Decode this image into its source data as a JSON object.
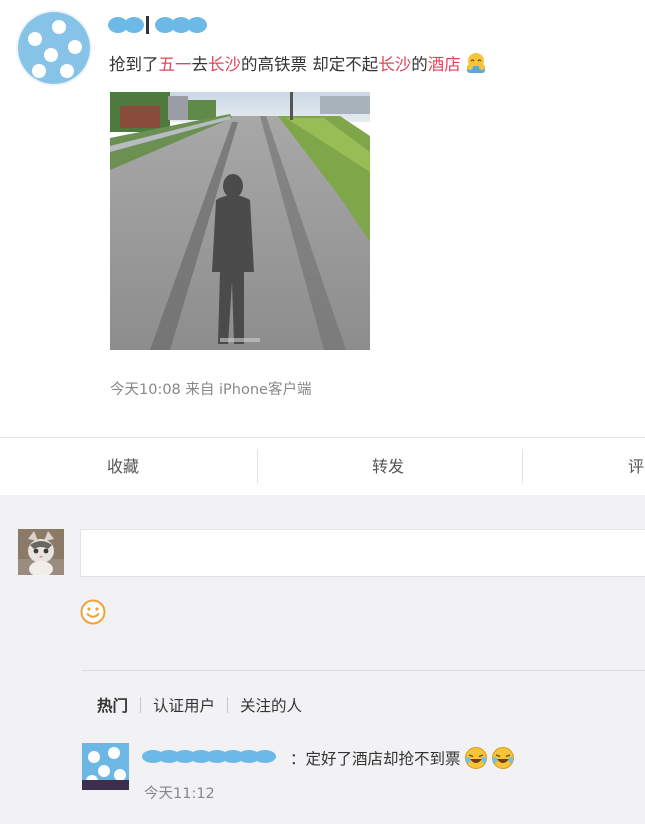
{
  "post": {
    "text_before": "抢到了",
    "hl1": "五一",
    "text2": "去",
    "hl2": "长沙",
    "text3": "的高铁票 却定不起",
    "hl3": "长沙",
    "text4": "的",
    "hl4": "酒店",
    "emoji": "hug-emoji",
    "meta": "今天10:08  来自 iPhone客户端"
  },
  "actions": {
    "favorite": "收藏",
    "repost": "转发",
    "comment": "评"
  },
  "comments": {
    "input_placeholder": "",
    "tabs": [
      "热门",
      "认证用户",
      "关注的人"
    ],
    "reply": {
      "text": "：定好了酒店却抢不到票",
      "time": "今天11:12"
    }
  },
  "colors": {
    "highlight": "#e0455c",
    "avatar_blue": "#87c3e6",
    "page_bg": "#f2f2f5"
  }
}
